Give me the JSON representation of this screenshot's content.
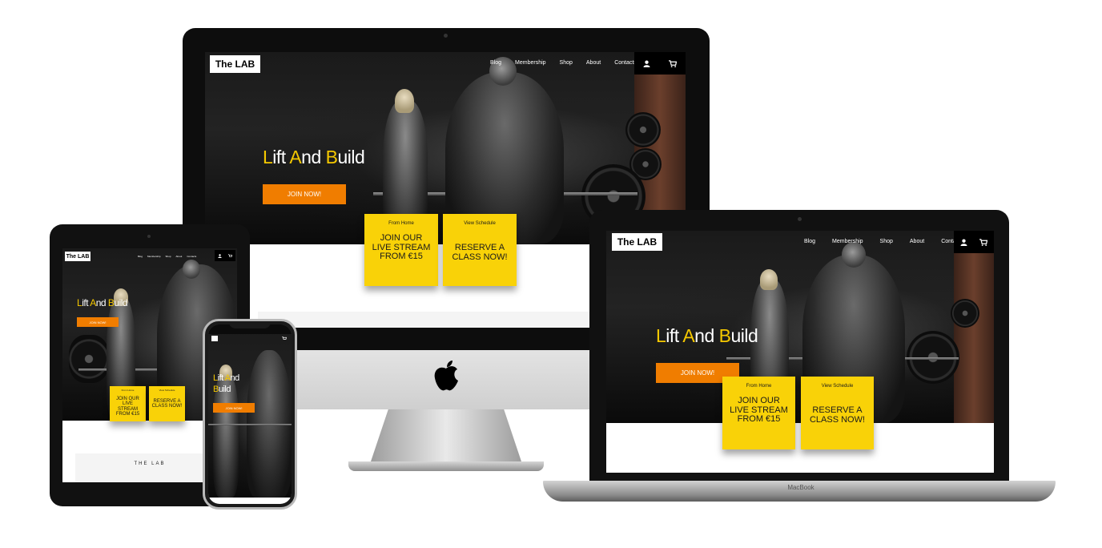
{
  "site": {
    "logo": "The LAB",
    "nav": [
      "Blog",
      "Membership",
      "Shop",
      "About",
      "Contacts"
    ],
    "icons": [
      "user-icon",
      "cart-icon"
    ],
    "tagline": {
      "l1": "L",
      "r1": "ift ",
      "l2": "A",
      "r2": "nd ",
      "l3": "B",
      "r3": "uild"
    },
    "join_label": "JOIN NOW!",
    "card1": {
      "small": "From Home",
      "big": "JOIN OUR LIVE STREAM FROM €15"
    },
    "card2": {
      "small": "View Schedule",
      "big": "RESERVE A CLASS NOW!"
    },
    "footer_brand": "THE LAB"
  },
  "devices": {
    "laptop_label": "MacBook"
  },
  "colors": {
    "accent_yellow": "#f9d208",
    "accent_orange": "#f07d00",
    "headline_yellow": "#f5c800"
  }
}
